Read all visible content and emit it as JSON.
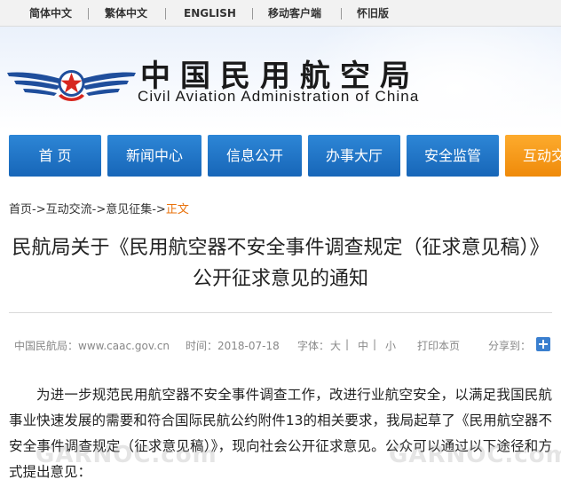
{
  "topbar": {
    "items": [
      "简体中文",
      "繁体中文",
      "ENGLISH",
      "移动客户端",
      "怀旧版"
    ]
  },
  "header": {
    "title_cn": "中国民用航空局",
    "title_en": "Civil Aviation Administration of China"
  },
  "nav": {
    "tabs": [
      "首 页",
      "新闻中心",
      "信息公开",
      "办事大厅",
      "安全监管",
      "互动交"
    ]
  },
  "breadcrumb": {
    "items": [
      "首页",
      "互动交流",
      "意见征集"
    ],
    "separator": "->",
    "current": "正文"
  },
  "article": {
    "title": "民航局关于《民用航空器不安全事件调查规定（征求意见稿）》公开征求意见的通知",
    "source": "中国民航局：www.caac.gov.cn",
    "time_label": "时间：",
    "time_value": "2018-07-18",
    "font_label": "字体：",
    "font_large": "大",
    "font_medium": "中",
    "font_small": "小",
    "print_label": "打印本页",
    "share_label": "分享到：",
    "body": "为进一步规范民用航空器不安全事件调查工作，改进行业航空安全，以满足我国民航事业快速发展的需要和符合国际民航公约附件13的相关要求，我局起草了《民用航空器不安全事件调查规定（征求意见稿）》，现向社会公开征求意见。公众可以通过以下途径和方式提出意见："
  },
  "watermark": {
    "text_left": "GARNOC.com",
    "text_right": "GARNOC.com"
  },
  "colors": {
    "nav_blue": "#1766b8",
    "nav_orange": "#ef8a0a",
    "accent_orange": "#e8710a",
    "logo_blue": "#1f4e9c",
    "logo_red": "#d7261e"
  }
}
